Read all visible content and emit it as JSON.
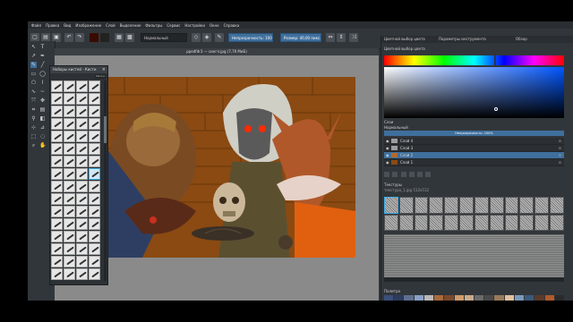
{
  "menubar": {
    "items": [
      "Файл",
      "Правка",
      "Вид",
      "Изображение",
      "Слой",
      "Выделение",
      "Фильтры",
      "Сервис",
      "Настройки",
      "Окно",
      "Справка"
    ]
  },
  "toolbar": {
    "blend_mode": "Нормальный",
    "opacity": "Непрозрачность: 100%",
    "size": "Размер: 40,00 пикс."
  },
  "document": {
    "tab_title": "ppedfdr3 — сингл.jpg (7,7б МиБ)"
  },
  "brush_panel": {
    "title": "Наборы кистей - Кисти",
    "filter": "Метка",
    "count": 64,
    "selected": 31
  },
  "docker": {
    "tabs": [
      "Цветной выбор цвета",
      "Параметры инструмента",
      "Обзор"
    ],
    "color_section_title": "Цветной выбор цвета",
    "hue_color": "#00aaff",
    "layers_title": "Слои",
    "blend_mode": "Нормальный",
    "opacity_label": "Непрозрачность: 100%",
    "layers": [
      {
        "name": "Слой 4",
        "selected": false
      },
      {
        "name": "Слой 3",
        "selected": false
      },
      {
        "name": "Слой 2",
        "selected": true
      },
      {
        "name": "Слой 1",
        "selected": false
      }
    ],
    "patterns_title": "Текстуры",
    "patterns_subtitle": "текстура_1.jpg 512x512",
    "palette_title": "Палитра",
    "palette_colors": [
      "#3b4f7a",
      "#2d3b5c",
      "#5e6f8d",
      "#8aa0c4",
      "#b9b9b9",
      "#a86a3c",
      "#7a4a2a",
      "#d19a6a",
      "#c8aa8a",
      "#6a6a6a",
      "#4a4a4a",
      "#9a7a5a",
      "#e0c0a0",
      "#7a9aba",
      "#3a5a7a",
      "#5a3a2a",
      "#b05a2a",
      "#2a2a2a"
    ],
    "palette_label": "символ"
  }
}
